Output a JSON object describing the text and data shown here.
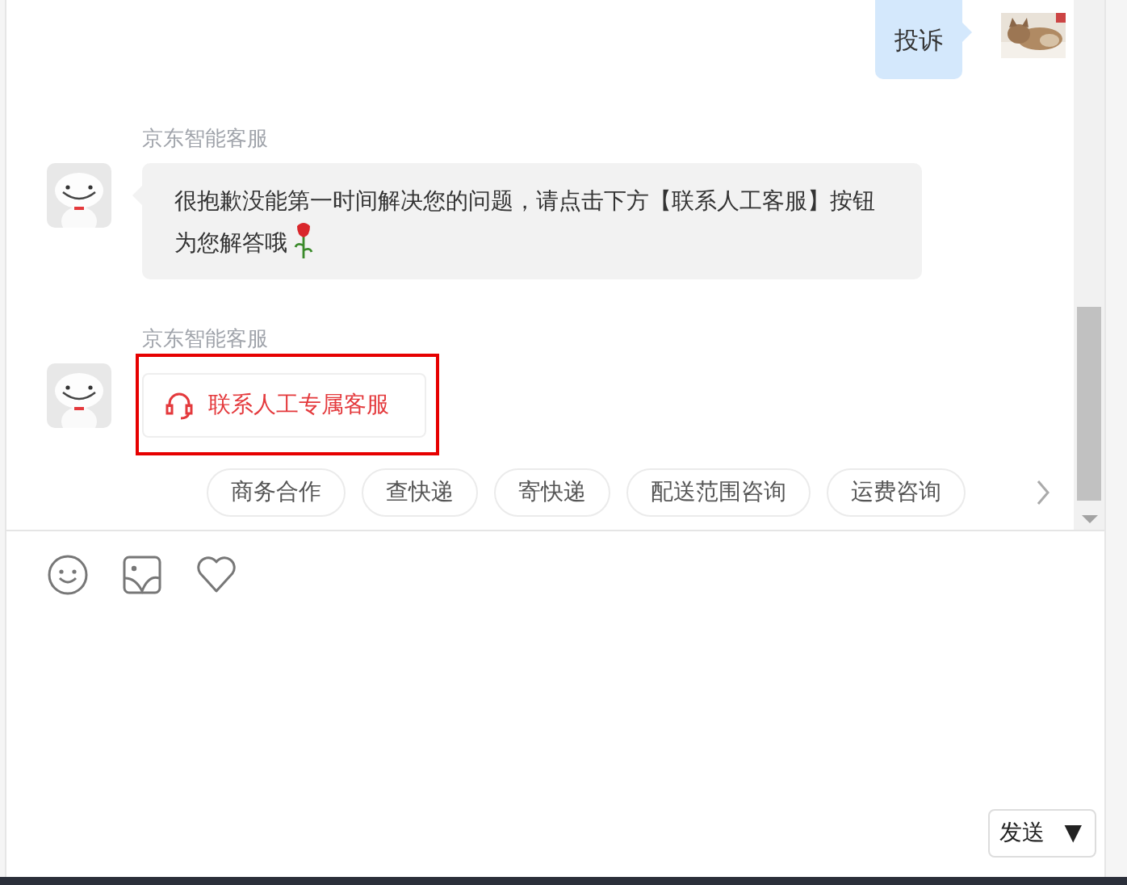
{
  "user_message": {
    "text": "投诉"
  },
  "bot_messages": [
    {
      "kind": "text",
      "sender": "京东智能客服",
      "text": "很抱歉没能第一时间解决您的问题，请点击下方【联系人工客服】按钮为您解答哦"
    },
    {
      "kind": "button",
      "sender": "京东智能客服",
      "text": "联系人工专属客服",
      "highlighted": true
    }
  ],
  "quick_replies": [
    "商务合作",
    "查快递",
    "寄快递",
    "配送范围咨询",
    "运费咨询"
  ],
  "send_button": {
    "label": "发送",
    "caret": "▼"
  }
}
